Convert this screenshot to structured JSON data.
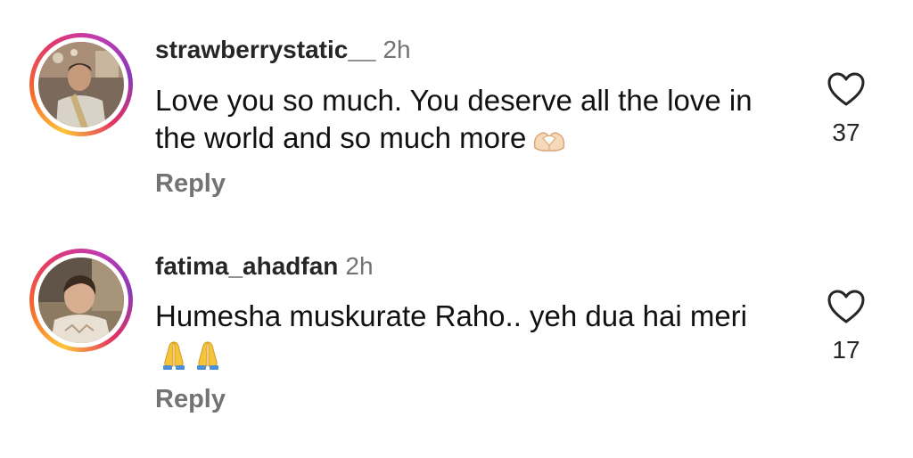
{
  "comments": [
    {
      "username": "strawberrystatic__",
      "time": "2h",
      "text": "Love you so much. You deserve all the love in the world and so much more",
      "emoji": "heart-hands-emoji",
      "reply_label": "Reply",
      "likes": "37"
    },
    {
      "username": "fatima_ahadfan",
      "time": "2h",
      "text": "Humesha muskurate Raho.. yeh dua hai meri",
      "emoji": "folded-hands-emoji",
      "reply_label": "Reply",
      "likes": "17"
    }
  ],
  "colors": {
    "username": "#262626",
    "secondary": "#737373",
    "story_ring": [
      "#fdc53a",
      "#f56a2c",
      "#e23a6a",
      "#c13bb1"
    ]
  }
}
